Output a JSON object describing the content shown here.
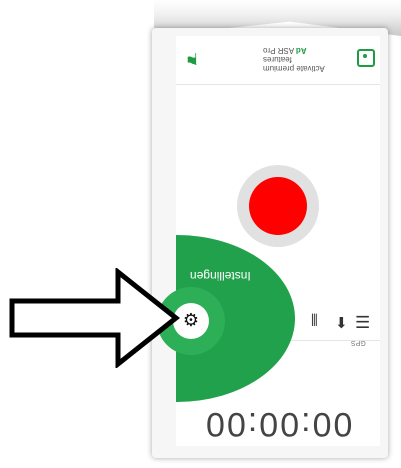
{
  "header": {
    "premium_title": "Activate premium features",
    "premium_pro": "ASR Pro",
    "premium_ad": "Ad"
  },
  "icons": {
    "language": "translate-icon",
    "premium": "premium-icon",
    "menu": "menu-icon",
    "mic": "microphone-icon",
    "wave": "waveform-icon",
    "settings": "gear-icon"
  },
  "toolbar": {
    "gps_label": "GPS"
  },
  "overlay": {
    "settings_label": "Instellingen"
  },
  "timer": {
    "value": "00:00:00"
  },
  "colors": {
    "green": "#22a14c",
    "record": "#ff0000"
  }
}
